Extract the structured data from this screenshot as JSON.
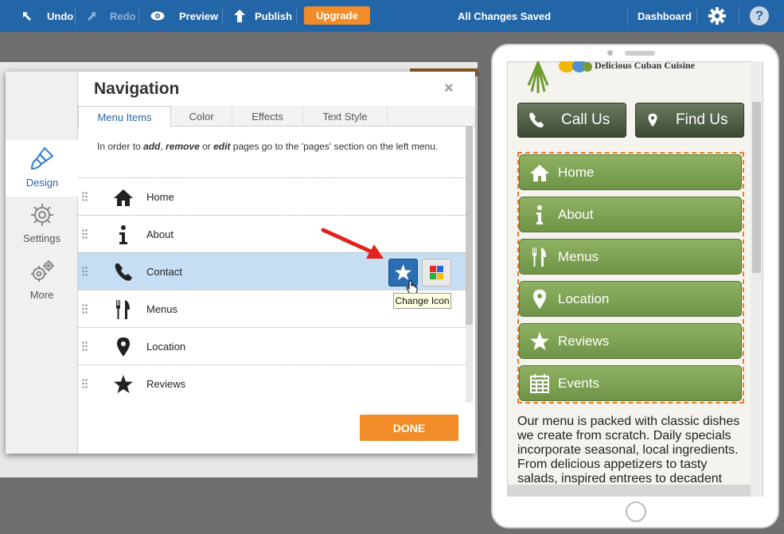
{
  "toolbar": {
    "undo_label": "Undo",
    "redo_label": "Redo",
    "preview_label": "Preview",
    "publish_label": "Publish",
    "upgrade_label": "Upgrade",
    "status_text": "All Changes Saved",
    "dashboard_label": "Dashboard",
    "help_label": "?"
  },
  "sidebar": {
    "items": [
      {
        "label": "Design",
        "icon": "paintbrush-icon",
        "active": true
      },
      {
        "label": "Settings",
        "icon": "gear-icon"
      },
      {
        "label": "More",
        "icon": "gears-icon"
      }
    ]
  },
  "dialog": {
    "title": "Navigation",
    "close_label": "×",
    "tabs": [
      "Menu Items",
      "Color",
      "Effects",
      "Text Style"
    ],
    "info": {
      "pre": "In order to ",
      "add": "add",
      "sep1": ", ",
      "remove": "remove",
      "sep2": " or ",
      "edit": "edit",
      "post": " pages go to the 'pages' section on the left menu."
    },
    "items": [
      {
        "label": "Home",
        "icon": "home-icon"
      },
      {
        "label": "About",
        "icon": "info-icon"
      },
      {
        "label": "Contact",
        "icon": "phone-icon",
        "selected": true
      },
      {
        "label": "Menus",
        "icon": "fork-knife-icon"
      },
      {
        "label": "Location",
        "icon": "map-pin-icon"
      },
      {
        "label": "Reviews",
        "icon": "star-icon"
      }
    ],
    "tooltip": "Change Icon",
    "done_label": "DONE"
  },
  "preview": {
    "brand_text": "Delicious Cuban Cuisine",
    "call_label": "Call Us",
    "find_label": "Find Us",
    "menu": [
      {
        "label": "Home",
        "icon": "home-icon"
      },
      {
        "label": "About",
        "icon": "info-icon"
      },
      {
        "label": "Menus",
        "icon": "fork-knife-icon"
      },
      {
        "label": "Location",
        "icon": "map-pin-icon"
      },
      {
        "label": "Reviews",
        "icon": "star-icon"
      },
      {
        "label": "Events",
        "icon": "calendar-icon"
      }
    ],
    "paragraph": "Our menu is packed with classic dishes we create from scratch. Daily specials incorporate seasonal, local ingredients. From delicious appetizers to tasty salads, inspired entrees to decadent"
  },
  "colors": {
    "toolbar": "#2366a8",
    "accent_orange": "#f28c28",
    "menu_green": "#7ba152",
    "selected_row": "#c5def4"
  }
}
